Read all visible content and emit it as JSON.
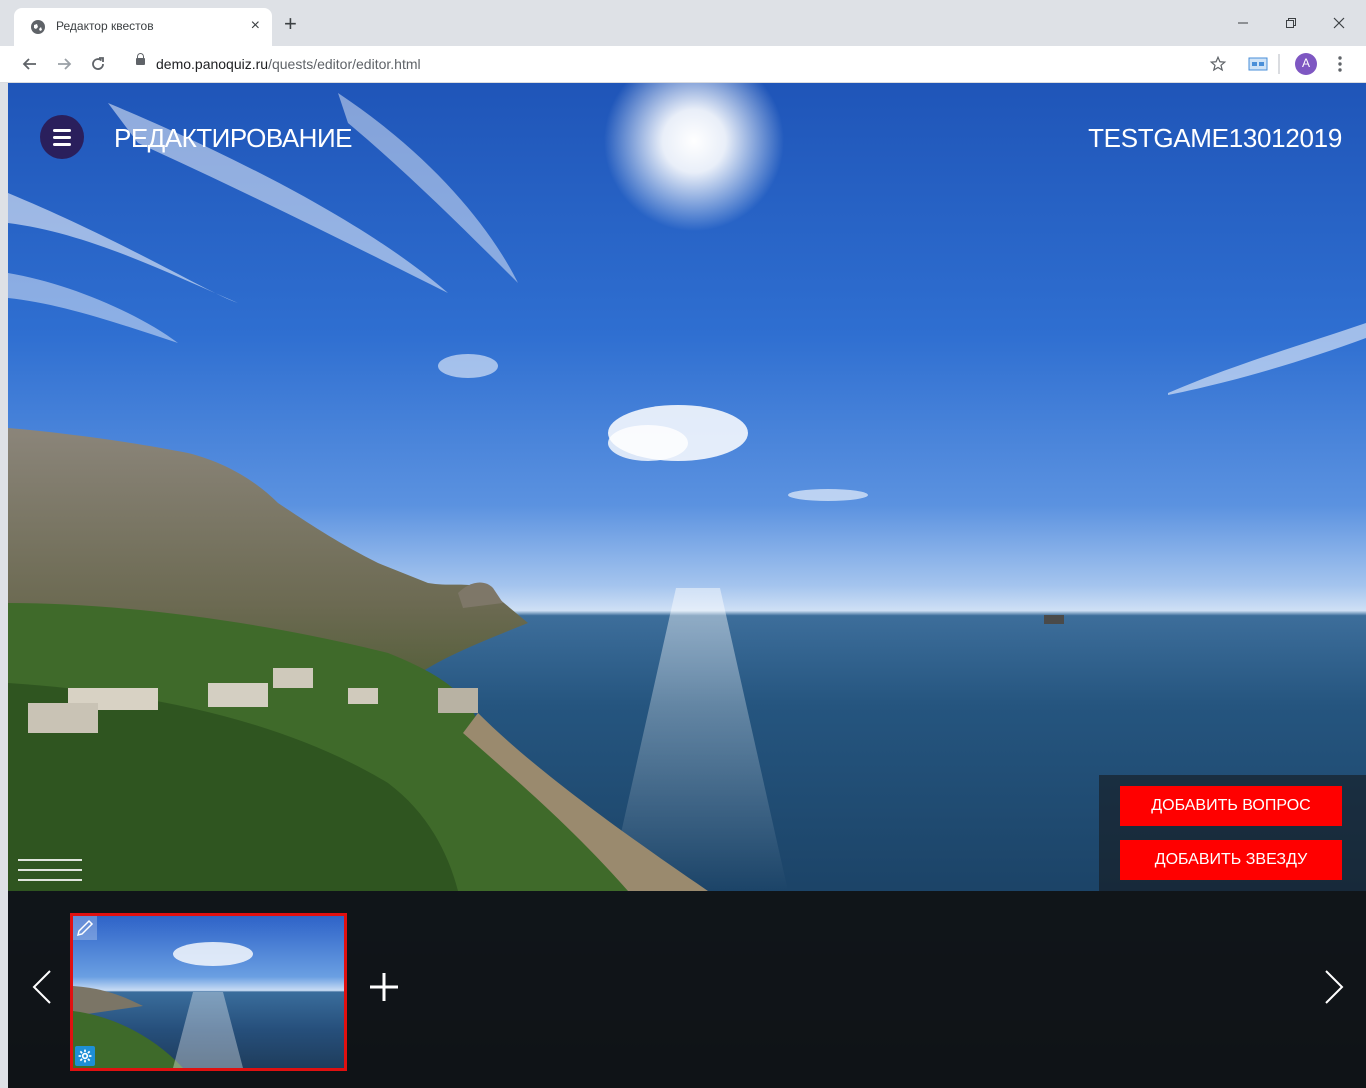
{
  "browser": {
    "tab_title": "Редактор квестов",
    "tab_close": "×",
    "new_tab": "+",
    "url_host": "demo.panoquiz.ru",
    "url_path": "/quests/editor/editor.html",
    "profile_initial": "A"
  },
  "header": {
    "title": "РЕДАКТИРОВАНИЕ",
    "game_name": "TESTGAME13012019"
  },
  "actions": {
    "add_question": "ДОБАВИТЬ ВОПРОС",
    "add_star": "ДОБАВИТЬ ЗВЕЗДУ"
  },
  "colors": {
    "menu_button": "#2a1f5c",
    "action_button": "#ff0000",
    "thumbnail_border": "#e01010",
    "settings_badge": "#1e8fd6"
  },
  "icons": [
    "globe-icon",
    "close-icon",
    "plus-icon",
    "back-icon",
    "forward-icon",
    "reload-icon",
    "lock-icon",
    "star-icon",
    "cast-icon",
    "avatar",
    "more-icon",
    "menu-icon",
    "edit-icon",
    "gear-icon",
    "chevron-left-icon",
    "chevron-right-icon"
  ]
}
